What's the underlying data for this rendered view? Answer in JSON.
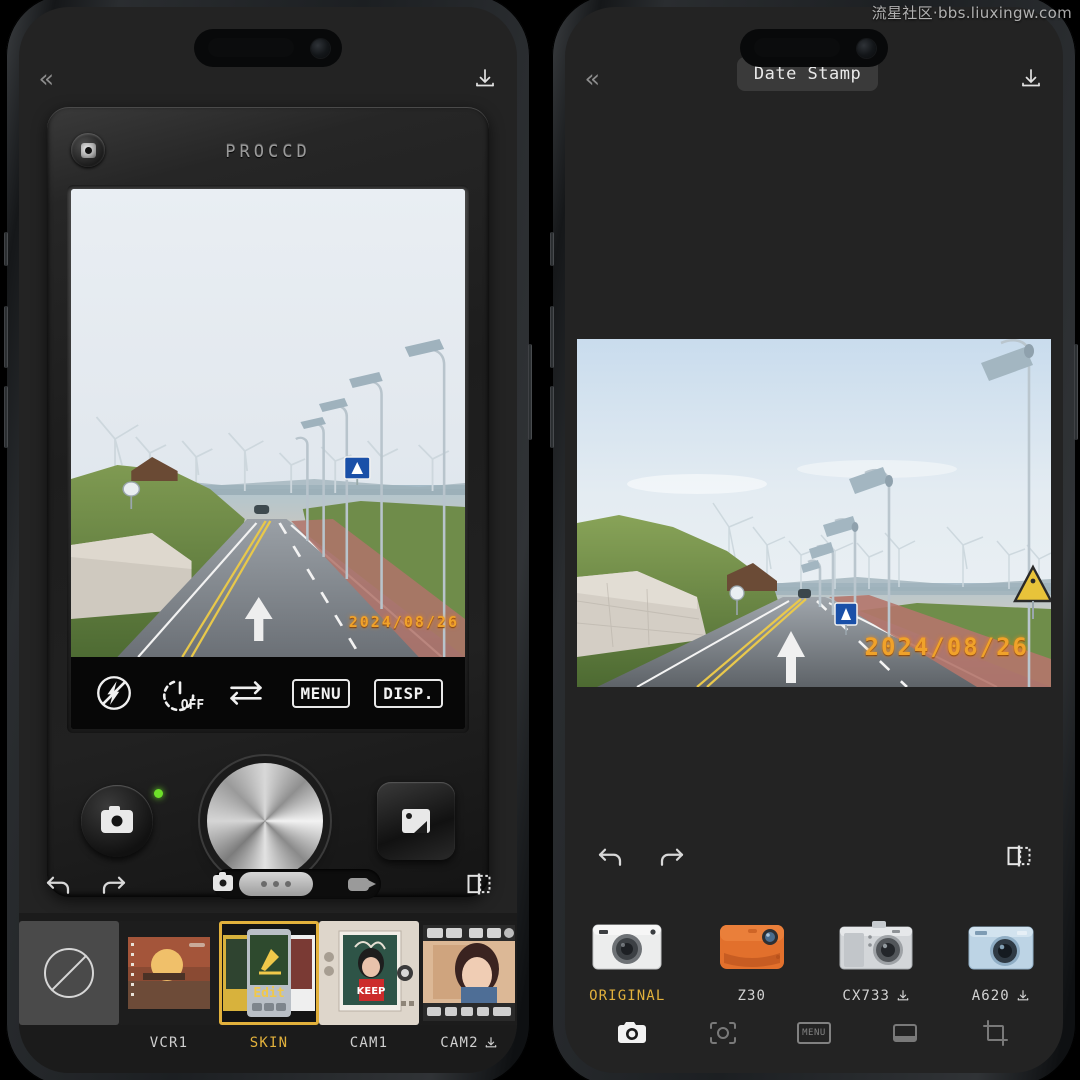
{
  "watermark": "流星社区·bbs.liuxingw.com",
  "left_phone": {
    "topbar": {
      "back_icon": "chevron-double-left-icon",
      "save_icon": "download-icon"
    },
    "camera_skin": {
      "brand": "PROCCD",
      "screw_icon": "dial-screw-icon",
      "controls": [
        {
          "name": "flash-off",
          "label": ""
        },
        {
          "name": "self-timer",
          "label": "OFF"
        },
        {
          "name": "switch-camera",
          "label": ""
        },
        {
          "name": "menu",
          "label": "MENU"
        },
        {
          "name": "display",
          "label": "DISP."
        }
      ],
      "shutter": {
        "mode_icon": "camera-mode-icon",
        "dial": "shutter-dial",
        "gallery_icon": "gallery-thumbnail-icon",
        "led": "#6ee02a"
      },
      "viewfinder_datestamp": "2024/08/26"
    },
    "lower_bar": {
      "undo_icon": "undo-icon",
      "redo_icon": "redo-icon",
      "photo_icon": "photo-mode-icon",
      "video_icon": "video-mode-icon",
      "compare_icon": "compare-split-icon"
    },
    "filters": [
      {
        "label": "",
        "name": "none",
        "selected": false,
        "downloadable": false
      },
      {
        "label": "VCR1",
        "name": "vcr1",
        "selected": false,
        "downloadable": false
      },
      {
        "label": "SKIN",
        "name": "skin",
        "selected": true,
        "downloadable": false
      },
      {
        "label": "CAM1",
        "name": "cam1",
        "selected": false,
        "downloadable": false
      },
      {
        "label": "CAM2",
        "name": "cam2",
        "selected": false,
        "downloadable": true
      }
    ],
    "filter_thumb_text": {
      "skin": "Edit",
      "cam1": "KEEP"
    }
  },
  "right_phone": {
    "topbar": {
      "back_icon": "chevron-double-left-icon",
      "title": "Date Stamp",
      "save_icon": "download-icon"
    },
    "photo_datestamp": "2024/08/26",
    "lower_bar": {
      "undo_icon": "undo-icon",
      "redo_icon": "redo-icon",
      "compare_icon": "compare-split-icon"
    },
    "camera_models": [
      {
        "label": "ORIGINAL",
        "name": "original",
        "selected": true,
        "downloadable": false,
        "color": "#e6e6e6"
      },
      {
        "label": "Z30",
        "name": "z30",
        "selected": false,
        "downloadable": false,
        "color": "#e2702c"
      },
      {
        "label": "CX733",
        "name": "cx733",
        "selected": false,
        "downloadable": true,
        "color": "#c9ccd0"
      },
      {
        "label": "A620",
        "name": "a620",
        "selected": false,
        "downloadable": true,
        "color": "#9fc3dd"
      }
    ],
    "tabs": [
      {
        "name": "camera",
        "label": "",
        "active": true
      },
      {
        "name": "focus-frame",
        "label": "",
        "active": false
      },
      {
        "name": "menu",
        "label": "MENU",
        "active": false
      },
      {
        "name": "border",
        "label": "",
        "active": false
      },
      {
        "name": "crop",
        "label": "",
        "active": false
      }
    ]
  },
  "accent": "#e2b13c",
  "stamp_color": "#f0a22a"
}
